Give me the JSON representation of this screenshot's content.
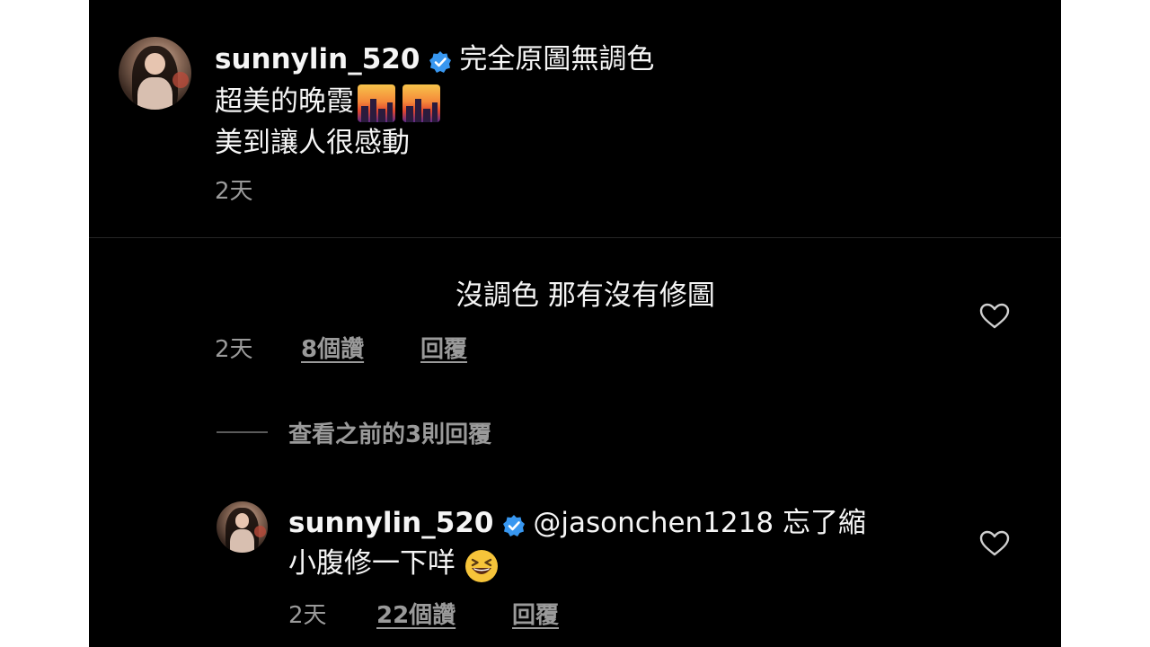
{
  "post": {
    "username": "sunnylin_520",
    "caption_line1": "完全原圖無調色",
    "caption_line2": "超美的晚霞",
    "caption_line3": "美到讓人很感動",
    "time": "2天"
  },
  "comment": {
    "text": "沒調色 那有沒有修圖",
    "time": "2天",
    "likes": "8個讚",
    "reply_label": "回覆"
  },
  "view_replies": "查看之前的3則回覆",
  "reply": {
    "username": "sunnylin_520",
    "mention": "@jasonchen1218",
    "text_line1": "忘了縮",
    "text_line2": "小腹修一下咩",
    "time": "2天",
    "likes": "22個讚",
    "reply_label": "回覆"
  },
  "icons": {
    "verified": "verified-badge-icon",
    "sunset_emoji": "city-sunset-emoji",
    "grin_emoji": "grinning-squinting-face-emoji",
    "heart": "heart-outline-icon"
  },
  "colors": {
    "background": "#000000",
    "text": "#f5f5f5",
    "muted": "#9a9a9a",
    "verified": "#3897f0"
  }
}
